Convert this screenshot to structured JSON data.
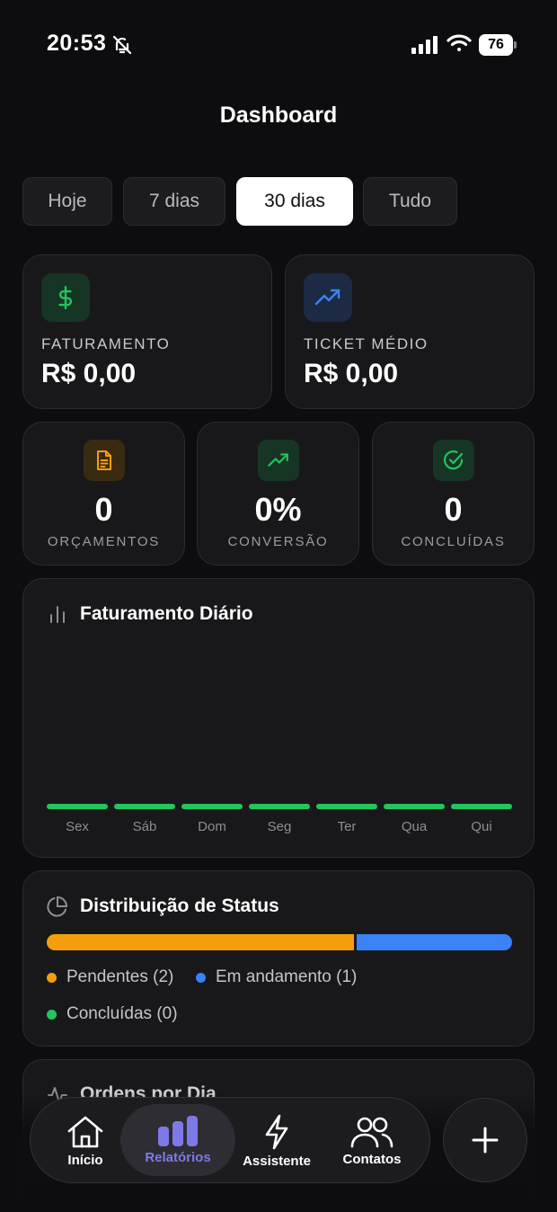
{
  "status_bar": {
    "time": "20:53",
    "battery": "76"
  },
  "header": {
    "title": "Dashboard"
  },
  "period_tabs": [
    {
      "label": "Hoje",
      "active": false
    },
    {
      "label": "7 dias",
      "active": false
    },
    {
      "label": "30 dias",
      "active": true
    },
    {
      "label": "Tudo",
      "active": false
    }
  ],
  "summary": {
    "revenue": {
      "label": "FATURAMENTO",
      "value": "R$ 0,00",
      "icon": "dollar-icon"
    },
    "ticket": {
      "label": "TICKET MÉDIO",
      "value": "R$ 0,00",
      "icon": "trending-up-icon"
    }
  },
  "stats": [
    {
      "value": "0",
      "label": "ORÇAMENTOS",
      "icon": "document-icon",
      "color": "#f59e0b"
    },
    {
      "value": "0%",
      "label": "CONVERSÃO",
      "icon": "trending-up-icon",
      "color": "#22c55e"
    },
    {
      "value": "0",
      "label": "CONCLUÍDAS",
      "icon": "check-circle-icon",
      "color": "#22c55e"
    }
  ],
  "daily_revenue": {
    "title": "Faturamento Diário",
    "days": [
      "Sex",
      "Sáb",
      "Dom",
      "Seg",
      "Ter",
      "Qua",
      "Qui"
    ],
    "values": [
      0,
      0,
      0,
      0,
      0,
      0,
      0
    ],
    "bar_color": "#22c55e"
  },
  "status_distribution": {
    "title": "Distribuição de Status",
    "items": [
      {
        "label": "Pendentes (2)",
        "count": 2,
        "color": "#f59e0b"
      },
      {
        "label": "Em andamento (1)",
        "count": 1,
        "color": "#3b82f6"
      },
      {
        "label": "Concluídas (0)",
        "count": 0,
        "color": "#22c55e"
      }
    ]
  },
  "orders_per_day": {
    "title": "Ordens por Dia"
  },
  "bottom_nav": [
    {
      "label": "Início",
      "icon": "home-icon",
      "active": false
    },
    {
      "label": "Relatórios",
      "icon": "bar-chart-icon",
      "active": true
    },
    {
      "label": "Assistente",
      "icon": "lightning-icon",
      "active": false
    },
    {
      "label": "Contatos",
      "icon": "users-icon",
      "active": false
    }
  ],
  "fab": {
    "icon": "plus-icon"
  },
  "colors": {
    "accent": "#7e79e8",
    "green": "#22c55e",
    "orange": "#f59e0b",
    "blue": "#3b82f6"
  }
}
